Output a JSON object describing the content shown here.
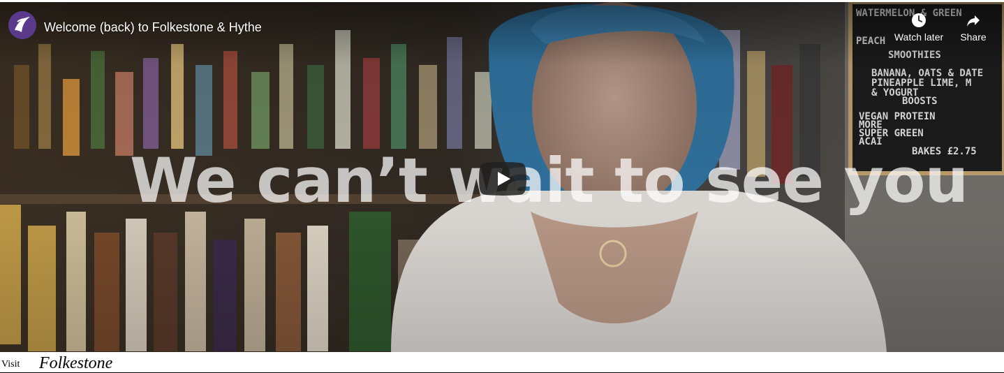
{
  "player": {
    "title": "Welcome (back) to Folkestone & Hythe",
    "overlay_text": "We can’t wait to see you",
    "watch_later_label": "Watch later",
    "share_label": "Share",
    "icons": {
      "channel": "channel-logo-icon",
      "watch_later": "clock-icon",
      "share": "share-arrow-icon",
      "play": "play-icon"
    },
    "play_button_color": "#212121",
    "sign_board": {
      "lines": [
        "WATERMELON & GREEN",
        "PEACH",
        "SMOOTHIES",
        "BANANA, OATS & DATE",
        "PINEAPPLE LIME, M",
        "& YOGURT",
        "BOOSTS",
        "VEGAN PROTEIN",
        "MORE",
        "SUPER GREEN",
        "ACAI",
        "BAKES £2.75"
      ]
    }
  },
  "caption": {
    "visit": "Visit",
    "place": "Folkestone"
  }
}
